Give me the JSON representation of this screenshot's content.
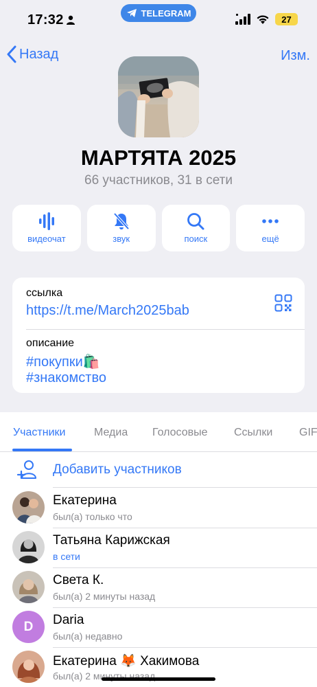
{
  "status": {
    "time": "17:32",
    "pill_label": "TELEGRAM",
    "battery": "27"
  },
  "nav": {
    "back_label": "Назад",
    "edit_label": "Изм."
  },
  "group": {
    "title": "МАРТЯТА 2025",
    "subtitle": "66 участников, 31 в сети"
  },
  "actions": [
    {
      "label": "видеочат",
      "icon": "voice-chat-icon"
    },
    {
      "label": "звук",
      "icon": "bell-slash-icon"
    },
    {
      "label": "поиск",
      "icon": "search-icon"
    },
    {
      "label": "ещё",
      "icon": "more-icon"
    }
  ],
  "info": {
    "link_label": "ссылка",
    "link": "https://t.me/March2025bab",
    "description_label": "описание",
    "tag1": "#покупки🛍️",
    "tag2": "#знакомство"
  },
  "tabs": [
    "Участники",
    "Медиа",
    "Голосовые",
    "Ссылки",
    "GIF"
  ],
  "add_members_label": "Добавить участников",
  "members": [
    {
      "name": "Екатерина",
      "status": "был(а) только что",
      "online": false
    },
    {
      "name": "Татьяна Карижская",
      "status": "в сети",
      "online": true
    },
    {
      "name": "Света К.",
      "status": "был(а) 2 минуты назад",
      "online": false
    },
    {
      "name": "Daria",
      "status": "был(а) недавно",
      "online": false,
      "initial": "D"
    },
    {
      "name": "Екатерина 🦊 Хакимова",
      "status": "был(а) 2 минуты назад",
      "online": false
    }
  ],
  "colors": {
    "accent": "#3478f6",
    "background": "#efeff4",
    "battery": "#f7d64a",
    "avatar_daria": "#c17de0"
  }
}
